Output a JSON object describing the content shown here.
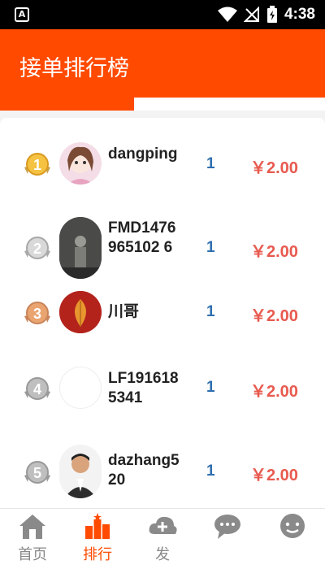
{
  "status_bar": {
    "time": "4:38",
    "left_icon_text": "A"
  },
  "header": {
    "title": "接单排行榜"
  },
  "ranking": [
    {
      "rank": "1",
      "name": "dangping",
      "count": "1",
      "amount": "￥2.00"
    },
    {
      "rank": "2",
      "name": "FMD1476965102 6",
      "count": "1",
      "amount": "￥2.00"
    },
    {
      "rank": "3",
      "name": "川哥",
      "count": "1",
      "amount": "￥2.00"
    },
    {
      "rank": "4",
      "name": "LF1916185341",
      "count": "1",
      "amount": "￥2.00"
    },
    {
      "rank": "5",
      "name": "dazhang520",
      "count": "1",
      "amount": "￥2.00"
    }
  ],
  "bottom_nav": [
    {
      "label": "首页",
      "icon": "home-icon"
    },
    {
      "label": "排行",
      "icon": "ranking-icon"
    },
    {
      "label": "发",
      "icon": "publish-icon"
    },
    {
      "label": "",
      "icon": "message-icon"
    },
    {
      "label": "",
      "icon": "profile-icon"
    }
  ],
  "colors": {
    "accent": "#ff4a00",
    "count": "#2f6fb0",
    "amount": "#e85a4f"
  }
}
